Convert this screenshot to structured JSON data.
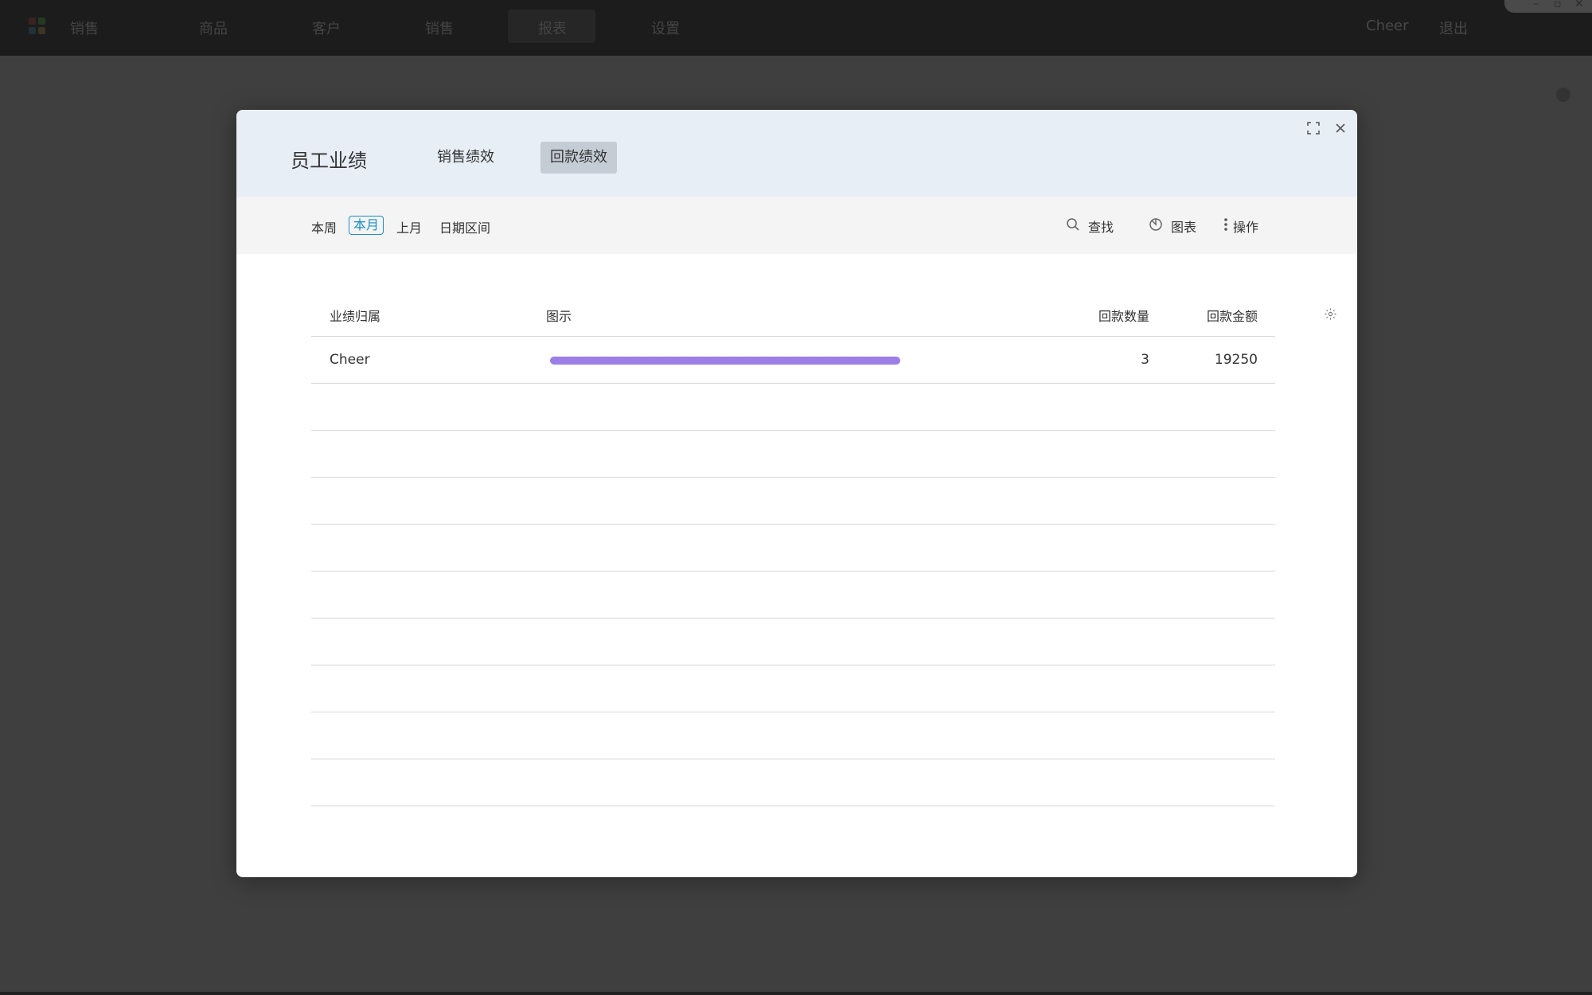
{
  "app": {
    "brand": "销售",
    "nav": [
      "商品",
      "客户",
      "销售",
      "报表",
      "设置"
    ],
    "active_nav": "报表",
    "user": "Cheer",
    "logout": "退出"
  },
  "dialog": {
    "title": "员工业绩",
    "tabs": [
      {
        "label": "销售绩效",
        "active": false
      },
      {
        "label": "回款绩效",
        "active": true
      }
    ],
    "periods": [
      {
        "label": "本周",
        "active": false
      },
      {
        "label": "本月",
        "active": true
      },
      {
        "label": "上月",
        "active": false
      },
      {
        "label": "日期区间",
        "active": false
      }
    ],
    "tools": {
      "search": "查找",
      "chart": "图表",
      "actions": "操作"
    },
    "table": {
      "columns": [
        "业绩归属",
        "图示",
        "回款数量",
        "回款金额"
      ],
      "rows": [
        {
          "owner": "Cheer",
          "bar_fraction": 1.0,
          "count": "3",
          "amount": "19250"
        }
      ],
      "empty_rows": 9
    }
  },
  "colors": {
    "accent": "#1b8dc4",
    "bar": "#9b7ee6",
    "header_bg": "#e8eef6",
    "active_tab_bg": "#c4ccd6"
  },
  "icons": [
    "app-logo-icon",
    "fullscreen-icon",
    "close-icon",
    "search-icon",
    "pie-chart-icon",
    "more-vertical-icon",
    "gear-icon"
  ]
}
